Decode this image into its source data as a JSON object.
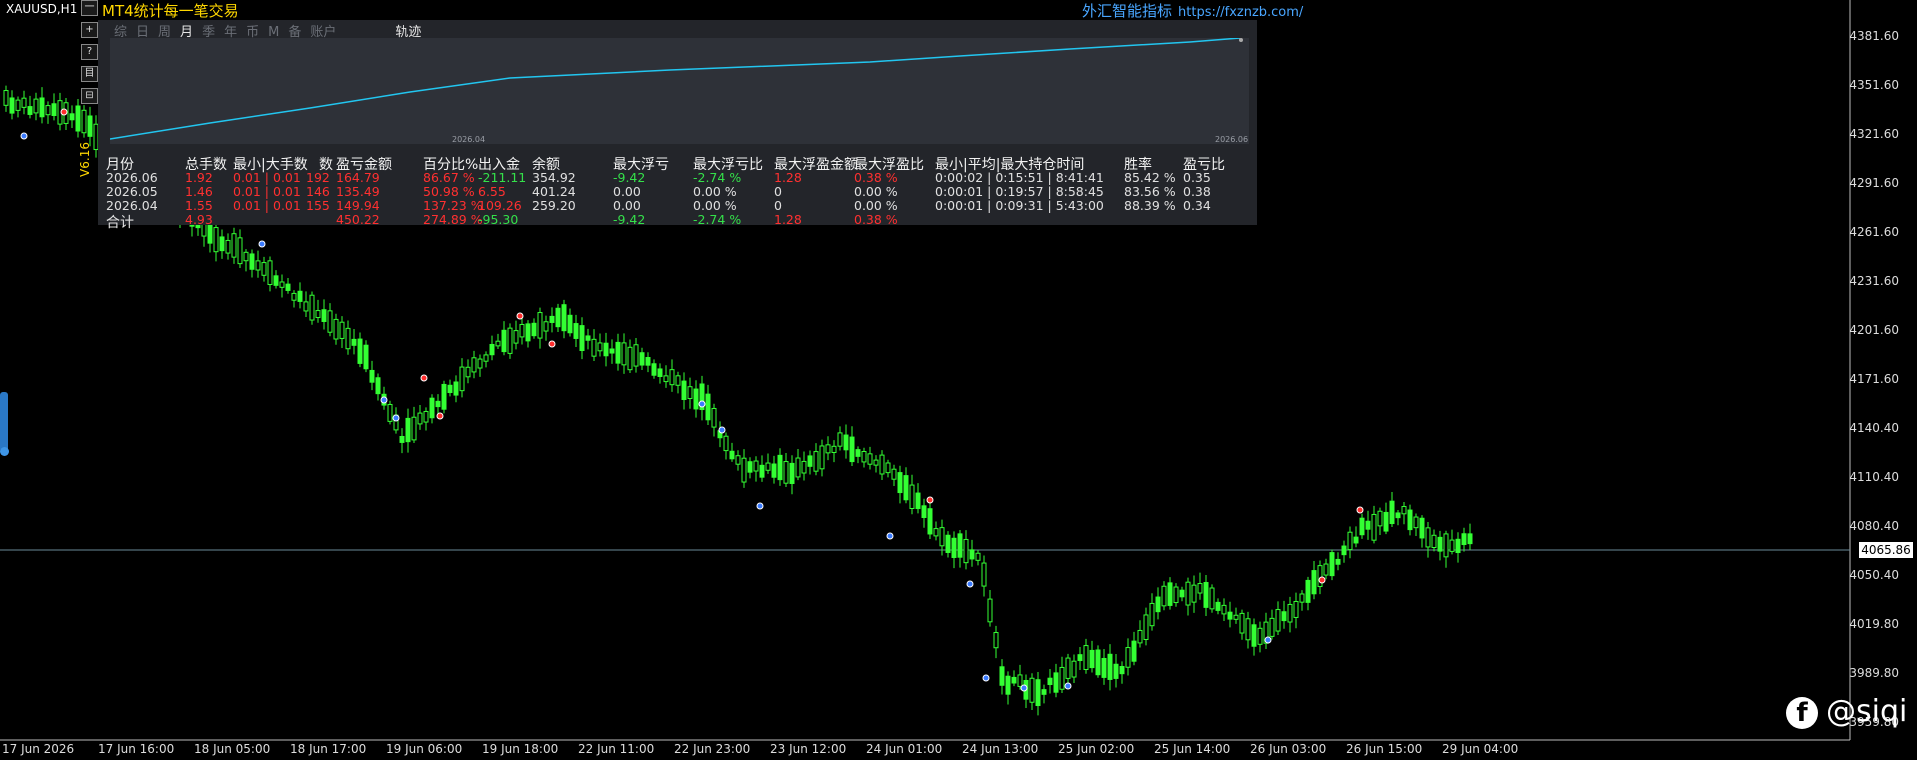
{
  "symbol": "XAUUSD,H1",
  "indicator": {
    "title": "MT4统计每一笔交易",
    "version": "V6.16",
    "brand": "外汇智能指标",
    "url": "https://fxznzb.com/",
    "toolbar": [
      "一",
      "+",
      "?",
      "目",
      "⊟"
    ],
    "tabs": [
      "综",
      "日",
      "周",
      "月",
      "季",
      "年",
      "币",
      "M",
      "备",
      "账户"
    ],
    "active_tab": "月",
    "track_tab": "轨迹",
    "plot_labels": {
      "start": "2026.04",
      "end": "2026.06"
    },
    "headers": [
      "月份",
      "总手数",
      "最小|大手数",
      "数",
      "盈亏金额",
      "百分比%",
      "出入金",
      "余额",
      "最大浮亏",
      "最大浮亏比",
      "最大浮盈金额",
      "最大浮盈比",
      "最小|平均|最大持仓时间",
      "胜率",
      "盈亏比"
    ],
    "rows": [
      {
        "month": "2026.06",
        "lots": "1.92",
        "minmax": "0.01 | 0.01",
        "count": "192",
        "pnl": "164.79",
        "pct": "86.67 %",
        "flow": "-211.11",
        "balance": "354.92",
        "max_dd": "-9.42",
        "max_dd_pct": "-2.74 %",
        "max_fp": "1.28",
        "max_fp_pct": "0.38 %",
        "hold": "0:00:02 | 0:15:51 | 8:41:41",
        "win": "85.42 %",
        "rr": "0.35"
      },
      {
        "month": "2026.05",
        "lots": "1.46",
        "minmax": "0.01 | 0.01",
        "count": "146",
        "pnl": "135.49",
        "pct": "50.98 %",
        "flow": "6.55",
        "balance": "401.24",
        "max_dd": "0.00",
        "max_dd_pct": "0.00 %",
        "max_fp": "0",
        "max_fp_pct": "0.00 %",
        "hold": "0:00:01 | 0:19:57 | 8:58:45",
        "win": "83.56 %",
        "rr": "0.38"
      },
      {
        "month": "2026.04",
        "lots": "1.55",
        "minmax": "0.01 | 0.01",
        "count": "155",
        "pnl": "149.94",
        "pct": "137.23 %",
        "flow": "109.26",
        "balance": "259.20",
        "max_dd": "0.00",
        "max_dd_pct": "0.00 %",
        "max_fp": "0",
        "max_fp_pct": "0.00 %",
        "hold": "0:00:01 | 0:09:31 | 5:43:00",
        "win": "88.39 %",
        "rr": "0.34"
      }
    ],
    "total": {
      "label": "合计",
      "lots": "4.93",
      "pnl": "450.22",
      "pct": "274.89 %",
      "flow": "-95.30",
      "max_dd": "-9.42",
      "max_dd_pct": "-2.74 %",
      "max_fp": "1.28",
      "max_fp_pct": "0.38 %"
    }
  },
  "price_axis": [
    "4381.60",
    "4351.60",
    "4321.60",
    "4291.60",
    "4261.60",
    "4231.60",
    "4201.60",
    "4171.60",
    "4140.40",
    "4110.40",
    "4080.40",
    "4050.40",
    "4019.80",
    "3989.80",
    "3959.80"
  ],
  "current_price": "4065.86",
  "time_axis": [
    "17 Jun 2026",
    "17 Jun 16:00",
    "18 Jun 05:00",
    "18 Jun 17:00",
    "19 Jun 06:00",
    "19 Jun 18:00",
    "22 Jun 11:00",
    "22 Jun 23:00",
    "23 Jun 12:00",
    "24 Jun 01:00",
    "24 Jun 13:00",
    "25 Jun 02:00",
    "25 Jun 14:00",
    "26 Jun 03:00",
    "26 Jun 15:00",
    "29 Jun 04:00"
  ],
  "watermark": "@siqi",
  "colors": {
    "bull": "#33ff33",
    "bear": "#000000",
    "equity_line": "#22c6f0",
    "panel_bg": "#23252a",
    "loss": "#ff3030",
    "gain": "#34e04a",
    "title": "#ffd700"
  }
}
